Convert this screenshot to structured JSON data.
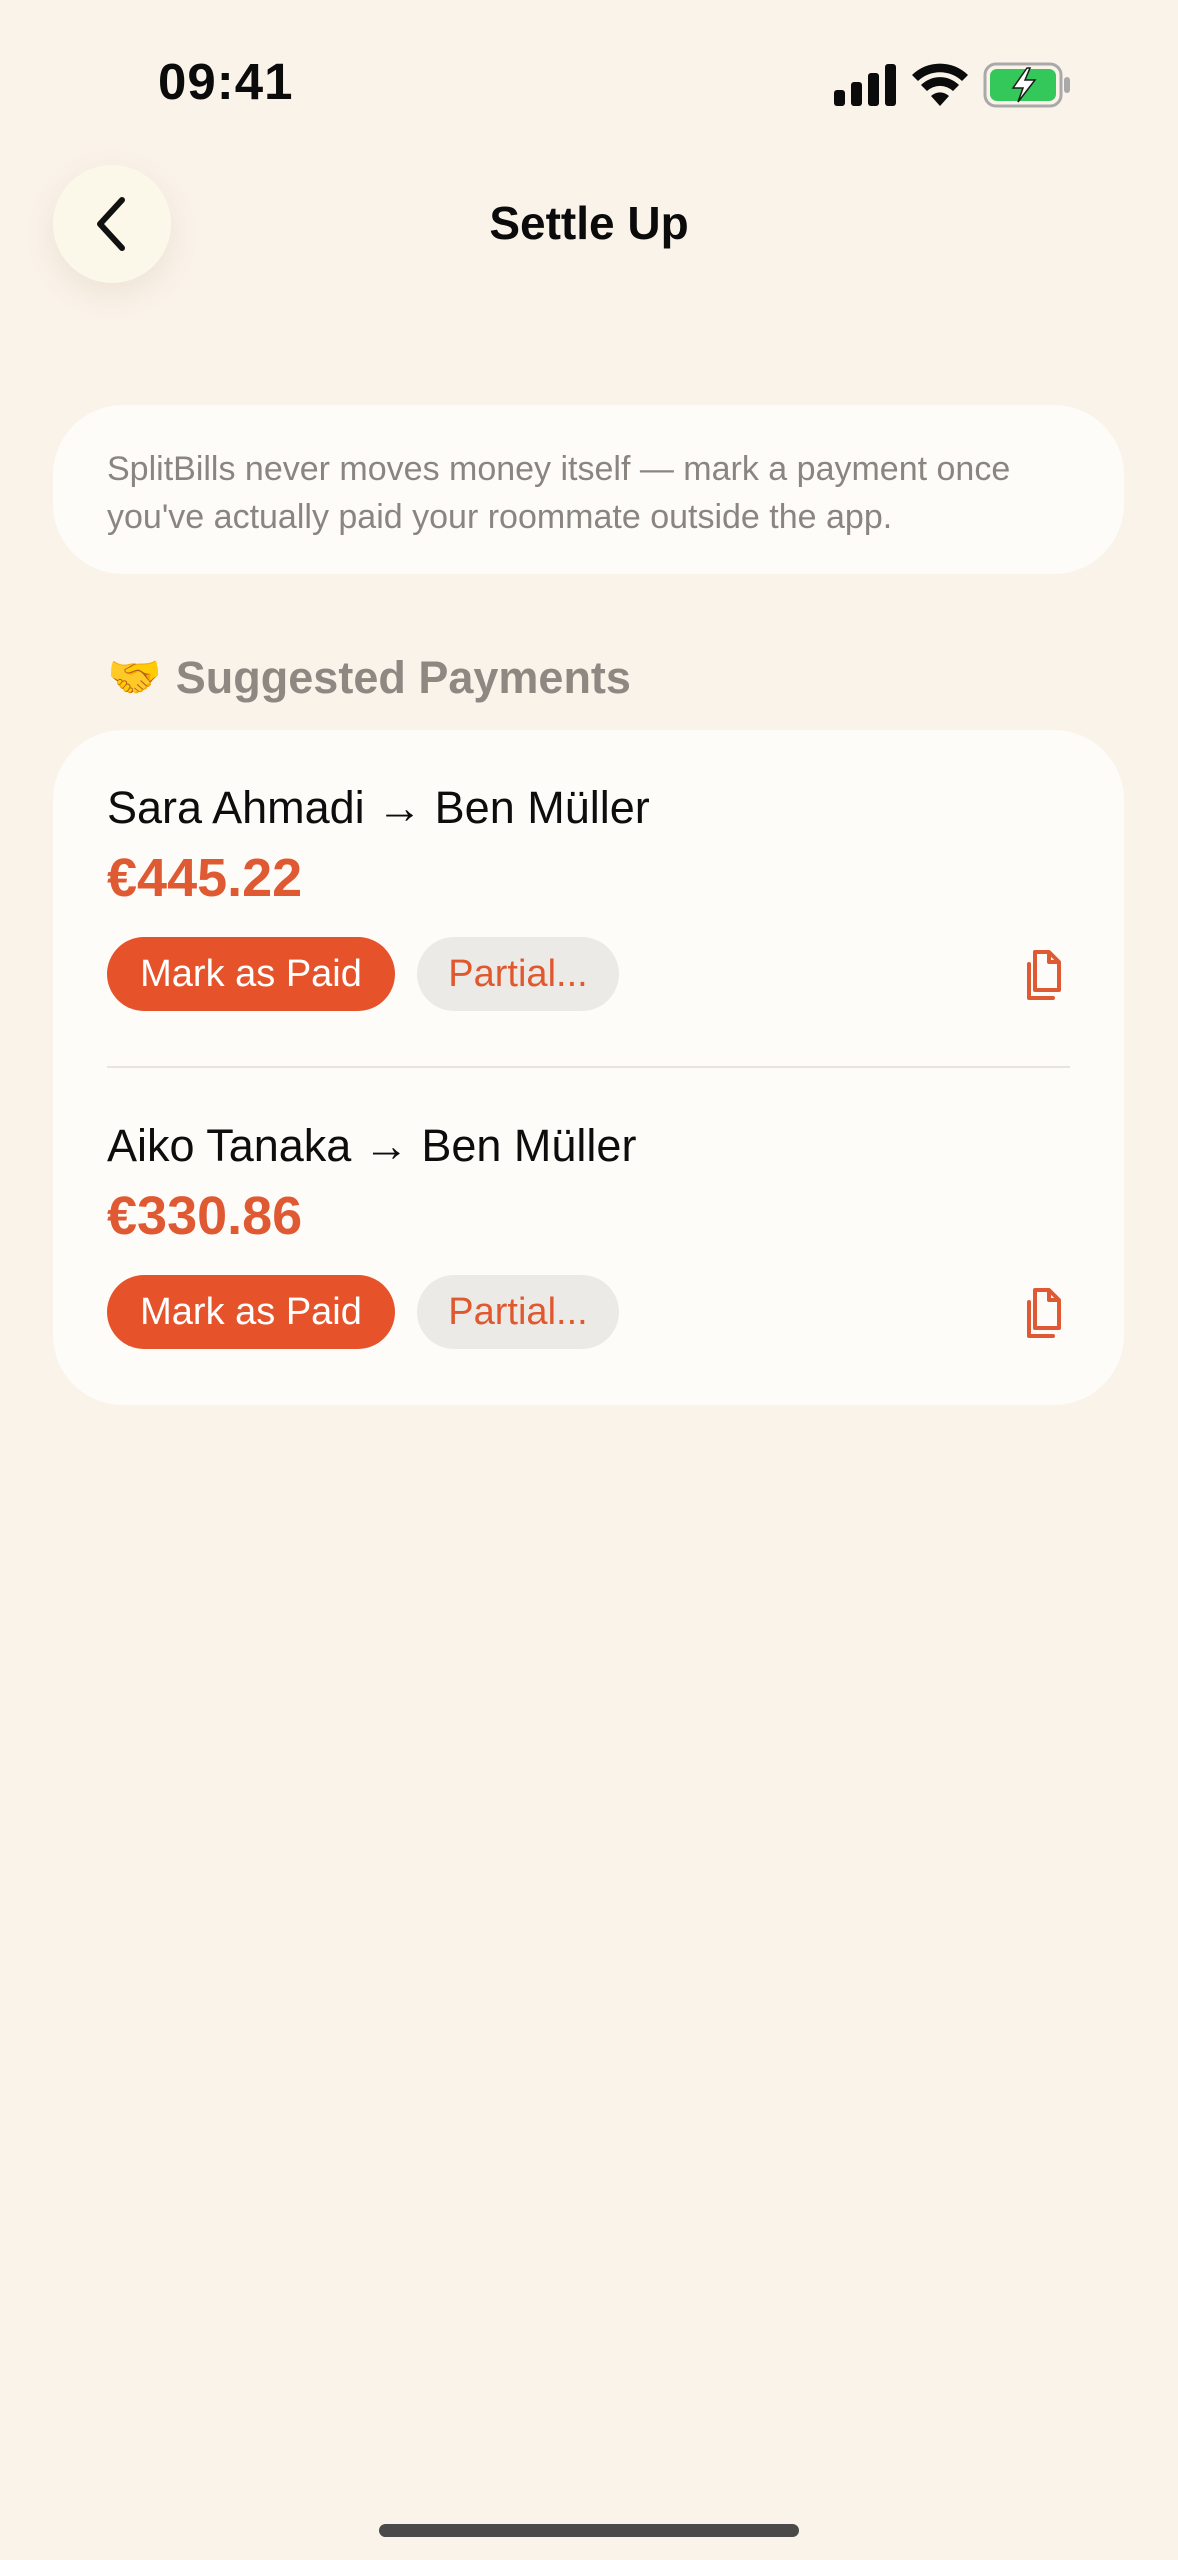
{
  "status_bar": {
    "time": "09:41",
    "icons": [
      "signal-icon",
      "wifi-icon",
      "battery-charging-icon"
    ],
    "battery_color": "#34C759"
  },
  "header": {
    "back_icon": "chevron-left-icon",
    "title": "Settle Up"
  },
  "info": {
    "text": "SplitBills never moves money itself — mark a payment once you've actually paid your roommate outside the app."
  },
  "section": {
    "emoji": "🤝",
    "title": "Suggested Payments"
  },
  "payments": [
    {
      "title": "Sara Ahmadi → Ben Müller",
      "amount": "€445.22",
      "mark_paid_label": "Mark as Paid",
      "partial_label": "Partial...",
      "copy_icon": "copy-icon"
    },
    {
      "title": "Aiko Tanaka → Ben Müller",
      "amount": "€330.86",
      "mark_paid_label": "Mark as Paid",
      "partial_label": "Partial...",
      "copy_icon": "copy-icon"
    }
  ],
  "colors": {
    "background": "#FAF3EA",
    "card": "#FEFCF8",
    "accent": "#E6532A",
    "amount": "#DF5A32",
    "muted_text": "#8a8580"
  }
}
